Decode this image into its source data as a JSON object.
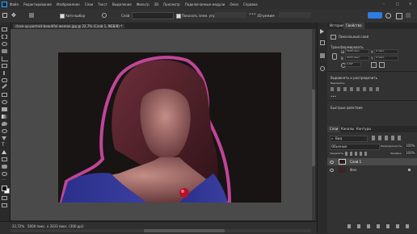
{
  "menu": {
    "logo": "Ps",
    "items": [
      "Файл",
      "Редактирование",
      "Изображение",
      "Слои",
      "Текст",
      "Выделение",
      "Фильтр",
      "3D",
      "Просмотр",
      "Подключаемые модули",
      "Окно",
      "Справка"
    ]
  },
  "options": {
    "auto_select": "Авто-выбор",
    "auto_select_value": "Слой",
    "show_controls": "Показать элем. упр.",
    "mode_3d": "3D-режим:"
  },
  "doc_tab": {
    "title": "close-up-portrait-beautiful-woman.jpg @ 22,7% (Слой 1, RGB/8) *"
  },
  "status": {
    "zoom": "22,72%",
    "info": "5000 пикс. x 3333 пикс. (300 ppi)"
  },
  "panel_tabs": {
    "history": "История",
    "properties": "Свойства"
  },
  "properties": {
    "layer_kind": "Пиксельный слой",
    "transform_header": "Трансформировать",
    "w": "5000 пикс.",
    "h": "3333 пикс.",
    "x": "0 пикс.",
    "y": "0 пикс.",
    "angle": "0,00°",
    "align_header": "Выровнять и распределить",
    "align_label": "Выровнять:",
    "quick_actions": "Быстрые действия"
  },
  "layers_tabs": {
    "layers": "Слои",
    "channels": "Каналы",
    "paths": "Контуры"
  },
  "layers_panel": {
    "kind_label": "Вид",
    "blend_mode": "Обычные",
    "opacity_label": "Непрозрачность:",
    "opacity_value": "100%",
    "lock_label": "Закрепить:",
    "fill_label": "Заливка:",
    "fill_value": "100%",
    "layers": [
      {
        "name": "Слой 1",
        "selected": true
      },
      {
        "name": "Фон",
        "selected": false
      }
    ]
  },
  "colors": {
    "accent": "#2f7de1",
    "glow": "#d14aa7",
    "panel": "#323232"
  }
}
